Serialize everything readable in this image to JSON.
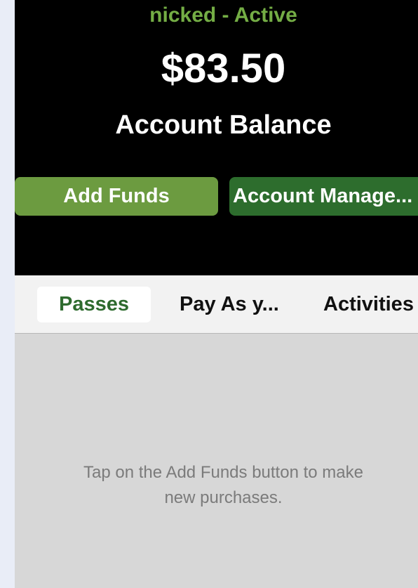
{
  "header": {
    "status_line": "nicked - Active",
    "balance": "$83.50",
    "balance_label": "Account Balance",
    "add_funds_label": "Add Funds",
    "account_manage_label": "Account Manage..."
  },
  "tabs": [
    {
      "label": "Passes",
      "selected": true
    },
    {
      "label": "Pay As y...",
      "selected": false
    },
    {
      "label": "Activities",
      "selected": false
    }
  ],
  "empty_state": {
    "line1": "Tap on the Add Funds button to make",
    "line2": "new purchases."
  },
  "colors": {
    "status_green": "#74ad45",
    "add_funds_green": "#6c9b40",
    "account_manage_green": "#2d6d2d",
    "selected_tab_text": "#2e6b2e",
    "header_background": "#000000",
    "content_background": "#d7d7d7"
  }
}
